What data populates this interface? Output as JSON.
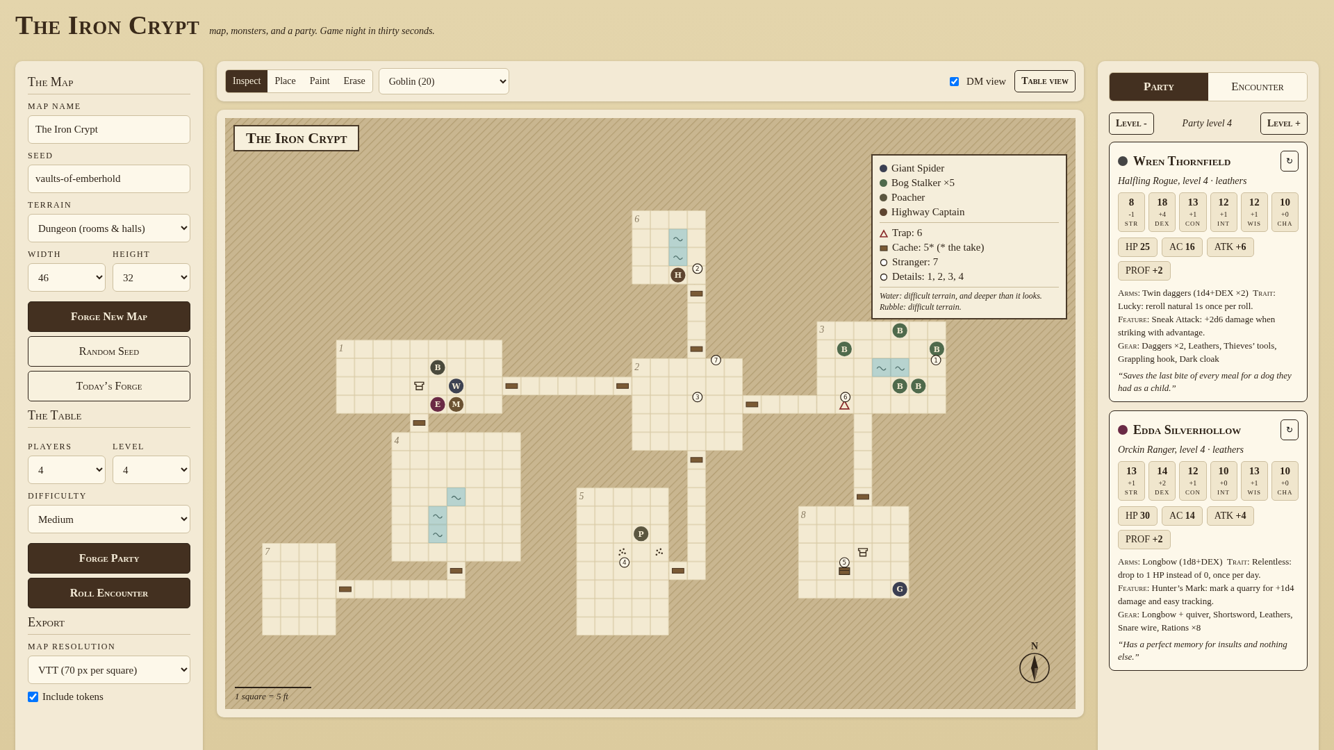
{
  "header": {
    "title": "The Iron Crypt",
    "tagline": "map, monsters, and a party. Game night in thirty seconds."
  },
  "sidebar": {
    "map_section": {
      "heading": "The Map",
      "map_name": {
        "label": "MAP NAME",
        "value": "The Iron Crypt"
      },
      "seed": {
        "label": "SEED",
        "value": "vaults-of-emberhold"
      },
      "terrain": {
        "label": "TERRAIN",
        "value": "Dungeon (rooms & halls)"
      },
      "width": {
        "label": "WIDTH",
        "value": "46"
      },
      "height": {
        "label": "HEIGHT",
        "value": "32"
      },
      "buttons": [
        {
          "label": "Forge New Map",
          "kind": "primary"
        },
        {
          "label": "Random Seed",
          "kind": "outline"
        },
        {
          "label": "Today’s Forge",
          "kind": "outline"
        }
      ]
    },
    "table_section": {
      "heading": "The Table",
      "players": {
        "label": "PLAYERS",
        "value": "4"
      },
      "level": {
        "label": "LEVEL",
        "value": "4"
      },
      "difficulty": {
        "label": "DIFFICULTY",
        "value": "Medium"
      },
      "buttons": [
        {
          "label": "Forge Party",
          "kind": "primary"
        },
        {
          "label": "Roll Encounter",
          "kind": "primary"
        }
      ]
    },
    "export_section": {
      "heading": "Export",
      "resolution": {
        "label": "MAP RESOLUTION",
        "value": "VTT (70 px per square)"
      },
      "include_tokens": {
        "label": "Include tokens",
        "checked": true
      }
    }
  },
  "toolbar": {
    "modes": [
      {
        "label": "Inspect",
        "selected": true
      },
      {
        "label": "Place",
        "selected": false
      },
      {
        "label": "Paint",
        "selected": false
      },
      {
        "label": "Erase",
        "selected": false
      }
    ],
    "creature_select": "Goblin (20)",
    "dm_view": {
      "label": "DM view",
      "checked": true
    },
    "table_view_button": "Table view"
  },
  "map": {
    "title": "The Iron Crypt",
    "rooms": [
      {
        "label": "1"
      },
      {
        "label": "2"
      },
      {
        "label": "3"
      },
      {
        "label": "4"
      },
      {
        "label": "5"
      },
      {
        "label": "6"
      },
      {
        "label": "7"
      },
      {
        "label": "8"
      }
    ],
    "tokens": [
      {
        "letter": "B",
        "color": "#4a4a3c"
      },
      {
        "letter": "W",
        "color": "#3d4252"
      },
      {
        "letter": "E",
        "color": "#6a2a45"
      },
      {
        "letter": "M",
        "color": "#6b5232"
      },
      {
        "letter": "H",
        "color": "#5e4530"
      },
      {
        "letter": "P",
        "color": "#5b5640"
      },
      {
        "letter": "B",
        "color": "#4f6a4c"
      },
      {
        "letter": "B",
        "color": "#4f6a4c"
      },
      {
        "letter": "B",
        "color": "#4f6a4c"
      },
      {
        "letter": "B",
        "color": "#4f6a4c"
      },
      {
        "letter": "B",
        "color": "#4f6a4c"
      },
      {
        "letter": "G",
        "color": "#3b3f52"
      }
    ],
    "markers": [
      {
        "label": "2"
      },
      {
        "label": "7"
      },
      {
        "label": "3"
      },
      {
        "label": "4"
      },
      {
        "label": "5"
      },
      {
        "label": "6"
      },
      {
        "label": "1"
      }
    ],
    "legend": {
      "monsters": [
        {
          "name": "Giant Spider",
          "color": "#3b3f52"
        },
        {
          "name": "Bog Stalker ×5",
          "color": "#4f6a4c"
        },
        {
          "name": "Poacher",
          "color": "#5b5640"
        },
        {
          "name": "Highway Captain",
          "color": "#5e4530"
        }
      ],
      "keys": [
        {
          "kind": "trap",
          "text": "Trap: 6"
        },
        {
          "kind": "cache",
          "text": "Cache: 5* (* the take)"
        },
        {
          "kind": "ring",
          "text": "Stranger: 7"
        },
        {
          "kind": "ring",
          "text": "Details: 1, 2, 3, 4"
        }
      ],
      "notes": [
        "Water: difficult terrain, and deeper than it looks.",
        "Rubble: difficult terrain."
      ]
    },
    "scale": "1 square = 5 ft",
    "compass": "N"
  },
  "right_panel": {
    "tabs": [
      {
        "label": "Party",
        "selected": true
      },
      {
        "label": "Encounter",
        "selected": false
      }
    ],
    "level_down": "Level -",
    "party_level": "Party level 4",
    "level_up": "Level +",
    "characters": [
      {
        "name": "Wren Thornfield",
        "color": "#454545",
        "reroll": "↻",
        "subtitle": "Halfling Rogue, level 4 · leathers",
        "stats": [
          {
            "score": "8",
            "mod": "-1",
            "label": "STR"
          },
          {
            "score": "18",
            "mod": "+4",
            "label": "DEX"
          },
          {
            "score": "13",
            "mod": "+1",
            "label": "CON"
          },
          {
            "score": "12",
            "mod": "+1",
            "label": "INT"
          },
          {
            "score": "12",
            "mod": "+1",
            "label": "WIS"
          },
          {
            "score": "10",
            "mod": "+0",
            "label": "CHA"
          }
        ],
        "badges": [
          {
            "label": "HP",
            "value": "25"
          },
          {
            "label": "AC",
            "value": "16"
          },
          {
            "label": "ATK",
            "value": "+6"
          },
          {
            "label": "PROF",
            "value": "+2"
          }
        ],
        "details": [
          [
            {
              "label": "Arms:",
              "text": "Twin daggers (1d4+DEX ×2)"
            },
            {
              "label": "Trait:",
              "text": "Lucky: reroll natural 1s once per roll."
            }
          ],
          [
            {
              "label": "Feature:",
              "text": "Sneak Attack: +2d6 damage when striking with advantage."
            }
          ],
          [
            {
              "label": "Gear:",
              "text": "Daggers ×2, Leathers, Thieves’ tools, Grappling hook, Dark cloak"
            }
          ]
        ],
        "quote": "“Saves the last bite of every meal for a dog they had as a child.”"
      },
      {
        "name": "Edda Silverhollow",
        "color": "#6a2a45",
        "reroll": "↻",
        "subtitle": "Orckin Ranger, level 4 · leathers",
        "stats": [
          {
            "score": "13",
            "mod": "+1",
            "label": "STR"
          },
          {
            "score": "14",
            "mod": "+2",
            "label": "DEX"
          },
          {
            "score": "12",
            "mod": "+1",
            "label": "CON"
          },
          {
            "score": "10",
            "mod": "+0",
            "label": "INT"
          },
          {
            "score": "13",
            "mod": "+1",
            "label": "WIS"
          },
          {
            "score": "10",
            "mod": "+0",
            "label": "CHA"
          }
        ],
        "badges": [
          {
            "label": "HP",
            "value": "30"
          },
          {
            "label": "AC",
            "value": "14"
          },
          {
            "label": "ATK",
            "value": "+4"
          },
          {
            "label": "PROF",
            "value": "+2"
          }
        ],
        "details": [
          [
            {
              "label": "Arms:",
              "text": "Longbow (1d8+DEX)"
            },
            {
              "label": "Trait:",
              "text": "Relentless: drop to 1 HP instead of 0, once per day."
            }
          ],
          [
            {
              "label": "Feature:",
              "text": "Hunter’s Mark: mark a quarry for +1d4 damage and easy tracking."
            }
          ],
          [
            {
              "label": "Gear:",
              "text": "Longbow + quiver, Shortsword, Leathers, Snare wire, Rations ×8"
            }
          ]
        ],
        "quote": "“Has a perfect memory for insults and nothing else.”"
      }
    ]
  }
}
